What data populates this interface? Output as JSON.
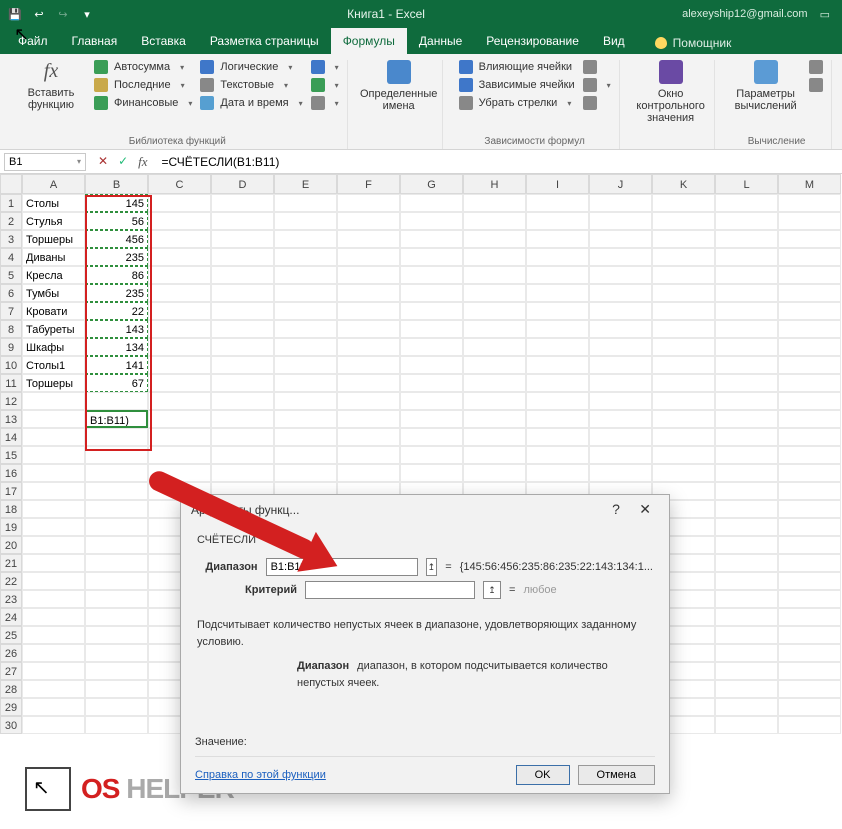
{
  "titlebar": {
    "doc": "Книга1  -  Excel",
    "user": "alexeyship12@gmail.com"
  },
  "tabs": {
    "file": "Файл",
    "home": "Главная",
    "insert": "Вставка",
    "layout": "Разметка страницы",
    "formulas": "Формулы",
    "data": "Данные",
    "review": "Рецензирование",
    "view": "Вид",
    "tellme": "Помощник"
  },
  "ribbon": {
    "insert_fn_1": "Вставить",
    "insert_fn_2": "функцию",
    "autosum": "Автосумма",
    "recent": "Последние",
    "financial": "Финансовые",
    "logical": "Логические",
    "text": "Текстовые",
    "datetime": "Дата и время",
    "group1": "Библиотека функций",
    "defined1": "Определенные",
    "defined2": "имена",
    "trace_prec": "Влияющие ячейки",
    "trace_dep": "Зависимые ячейки",
    "remove_arrows": "Убрать стрелки",
    "group2": "Зависимости формул",
    "watch1": "Окно контрольного",
    "watch2": "значения",
    "calc1": "Параметры",
    "calc2": "вычислений",
    "group3": "Вычисление"
  },
  "namebox": "B1",
  "formula": "=СЧЁТЕСЛИ(B1:B11)",
  "cols": [
    "A",
    "B",
    "C",
    "D",
    "E",
    "F",
    "G",
    "H",
    "I",
    "J",
    "K",
    "L",
    "M"
  ],
  "rows": {
    "labels": [
      "Столы",
      "Стулья",
      "Торшеры",
      "Диваны",
      "Кресла",
      "Тумбы",
      "Кровати",
      "Табуреты",
      "Шкафы",
      "Столы1",
      "Торшеры"
    ],
    "values": [
      145,
      56,
      456,
      235,
      86,
      235,
      22,
      143,
      134,
      141,
      67
    ],
    "b13": "B1:B11)"
  },
  "dialog": {
    "title": "Аргументы функц...",
    "func": "СЧЁТЕСЛИ",
    "range_label": "Диапазон",
    "range_value": "B1:B11",
    "range_preview": "{145:56:456:235:86:235:22:143:134:1...",
    "criteria_label": "Критерий",
    "criteria_preview": "любое",
    "desc1": "Подсчитывает количество непустых ячеек в диапазоне, удовлетворяющих заданному условию.",
    "desc2_label": "Диапазон",
    "desc2_text": "диапазон, в котором подсчитывается количество непустых ячеек.",
    "value_label": "Значение:",
    "help": "Справка по этой функции",
    "ok": "OK",
    "cancel": "Отмена"
  },
  "watermark": {
    "os": "OS",
    "helper": "HELPER"
  }
}
